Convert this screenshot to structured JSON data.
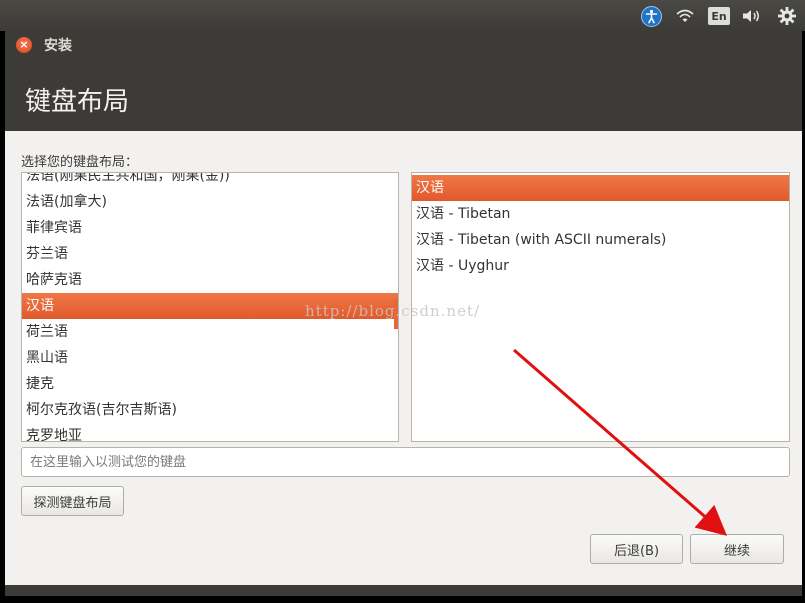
{
  "top_panel": {
    "lang_indicator": "En",
    "icons": [
      "accessibility-icon",
      "wifi-icon",
      "volume-icon",
      "gear-icon"
    ]
  },
  "window": {
    "title": "安装",
    "page_title": "键盘布局"
  },
  "prompt": "选择您的键盘布局：",
  "layouts": {
    "items": [
      {
        "label": "法语(刚果民主共和国，刚果(金))",
        "selected": false
      },
      {
        "label": "法语(加拿大)",
        "selected": false
      },
      {
        "label": "菲律宾语",
        "selected": false
      },
      {
        "label": "芬兰语",
        "selected": false
      },
      {
        "label": "哈萨克语",
        "selected": false
      },
      {
        "label": "汉语",
        "selected": true
      },
      {
        "label": "荷兰语",
        "selected": false
      },
      {
        "label": "黑山语",
        "selected": false
      },
      {
        "label": "捷克",
        "selected": false
      },
      {
        "label": "柯尔克孜语(吉尔吉斯语)",
        "selected": false
      },
      {
        "label": "克罗地亚",
        "selected": false
      }
    ]
  },
  "variants": {
    "items": [
      {
        "label": "汉语",
        "selected": true
      },
      {
        "label": "汉语 - Tibetan",
        "selected": false
      },
      {
        "label": "汉语 - Tibetan (with ASCII numerals)",
        "selected": false
      },
      {
        "label": "汉语 - Uyghur",
        "selected": false
      }
    ]
  },
  "test_input": {
    "placeholder": "在这里输入以测试您的键盘",
    "value": ""
  },
  "buttons": {
    "detect": "探测键盘布局",
    "back": "后退(B)",
    "continue": "继续"
  },
  "watermark": "http://blog.csdn.net/",
  "colors": {
    "accent": "#e9642f",
    "panel": "#3c3b37",
    "window_bg": "#f2f1f0",
    "arrow": "#e01010"
  }
}
